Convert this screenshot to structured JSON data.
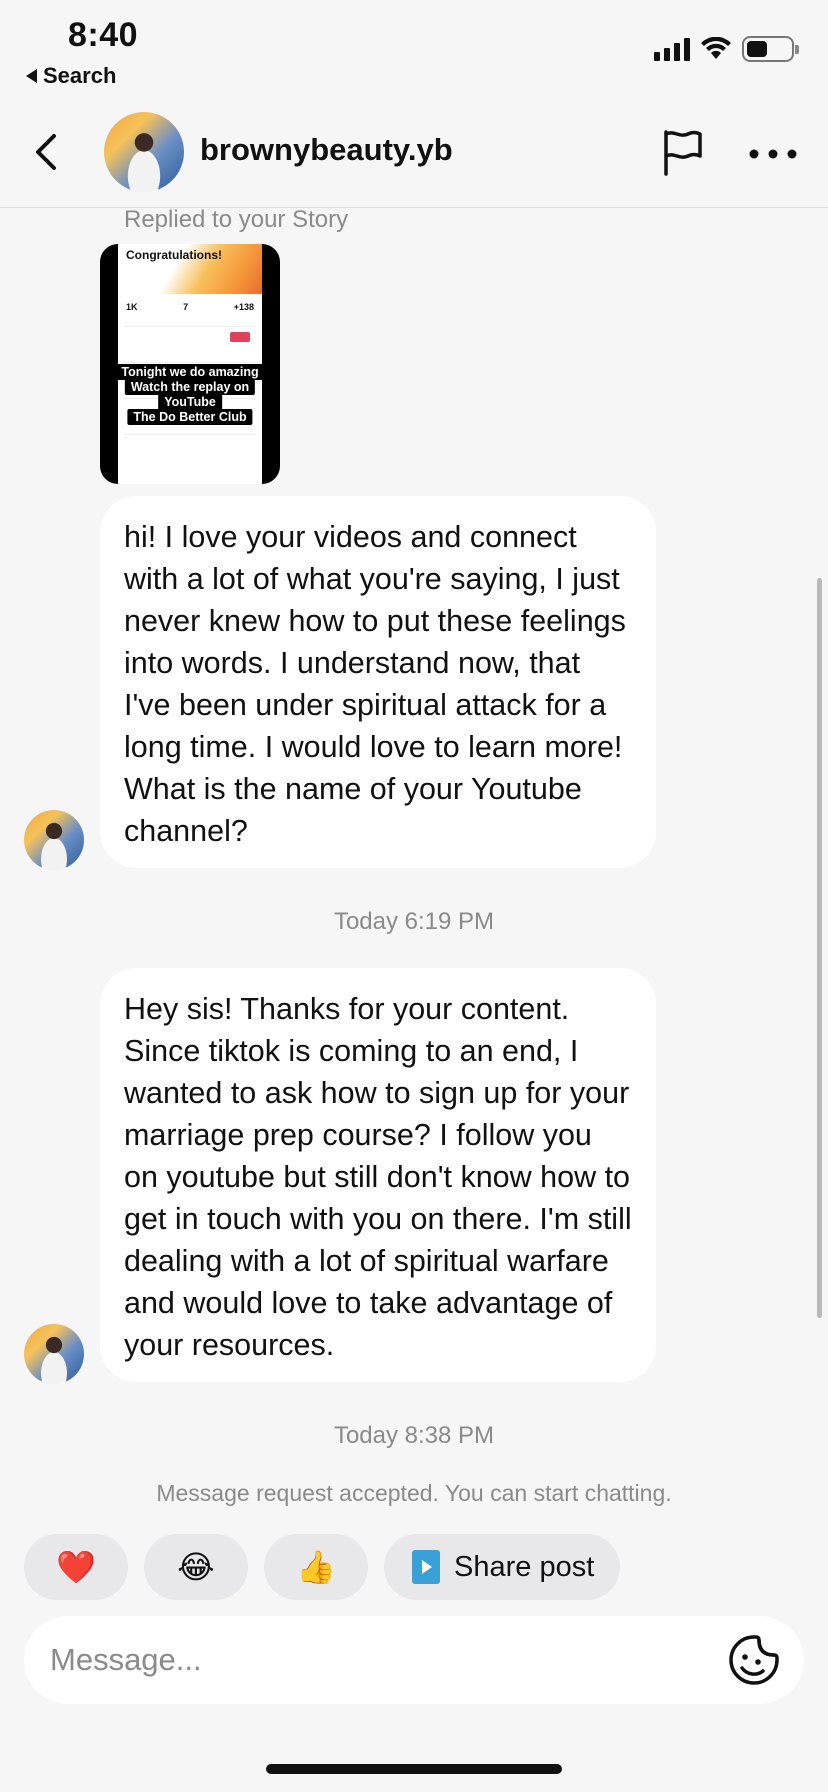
{
  "status_bar": {
    "time": "8:40",
    "back_app_label": "Search"
  },
  "header": {
    "username": "brownybeauty.yb"
  },
  "story_reply": {
    "label": "Replied to your Story",
    "thumbnail": {
      "banner_title": "Congratulations!",
      "stats": [
        "1K",
        "7",
        "+138"
      ],
      "overlay_lines": [
        "Tonight we do amazing",
        "Watch the replay on",
        "YouTube",
        "The Do Better Club"
      ]
    }
  },
  "messages": [
    {
      "text": "hi! I love your videos and connect with a lot of what you're saying, I just never knew how to put these feelings into words. I understand now, that I've been under spiritual attack for a long time. I would love to learn more! What is the name of your Youtube channel?"
    },
    {
      "timestamp": "Today 6:19 PM",
      "text": "Hey sis! Thanks for your content. Since tiktok is coming to an end, I wanted to ask how to sign up for your marriage prep course? I follow you on youtube but still don't know how to get in touch with you on there. I'm still dealing with a lot of spiritual warfare and would love to take advantage of your resources."
    }
  ],
  "timestamp_2": "Today 8:38 PM",
  "system_message": "Message request accepted. You can start chatting.",
  "quick_replies": {
    "heart": "❤️",
    "laugh": "😂",
    "thumbs_up": "👍",
    "share_post": "Share post"
  },
  "composer": {
    "placeholder": "Message..."
  },
  "colors": {
    "background": "#f6f6f7",
    "bubble": "#ffffff",
    "muted_text": "#8a8a8a",
    "share_icon": "#3aa0d8"
  }
}
